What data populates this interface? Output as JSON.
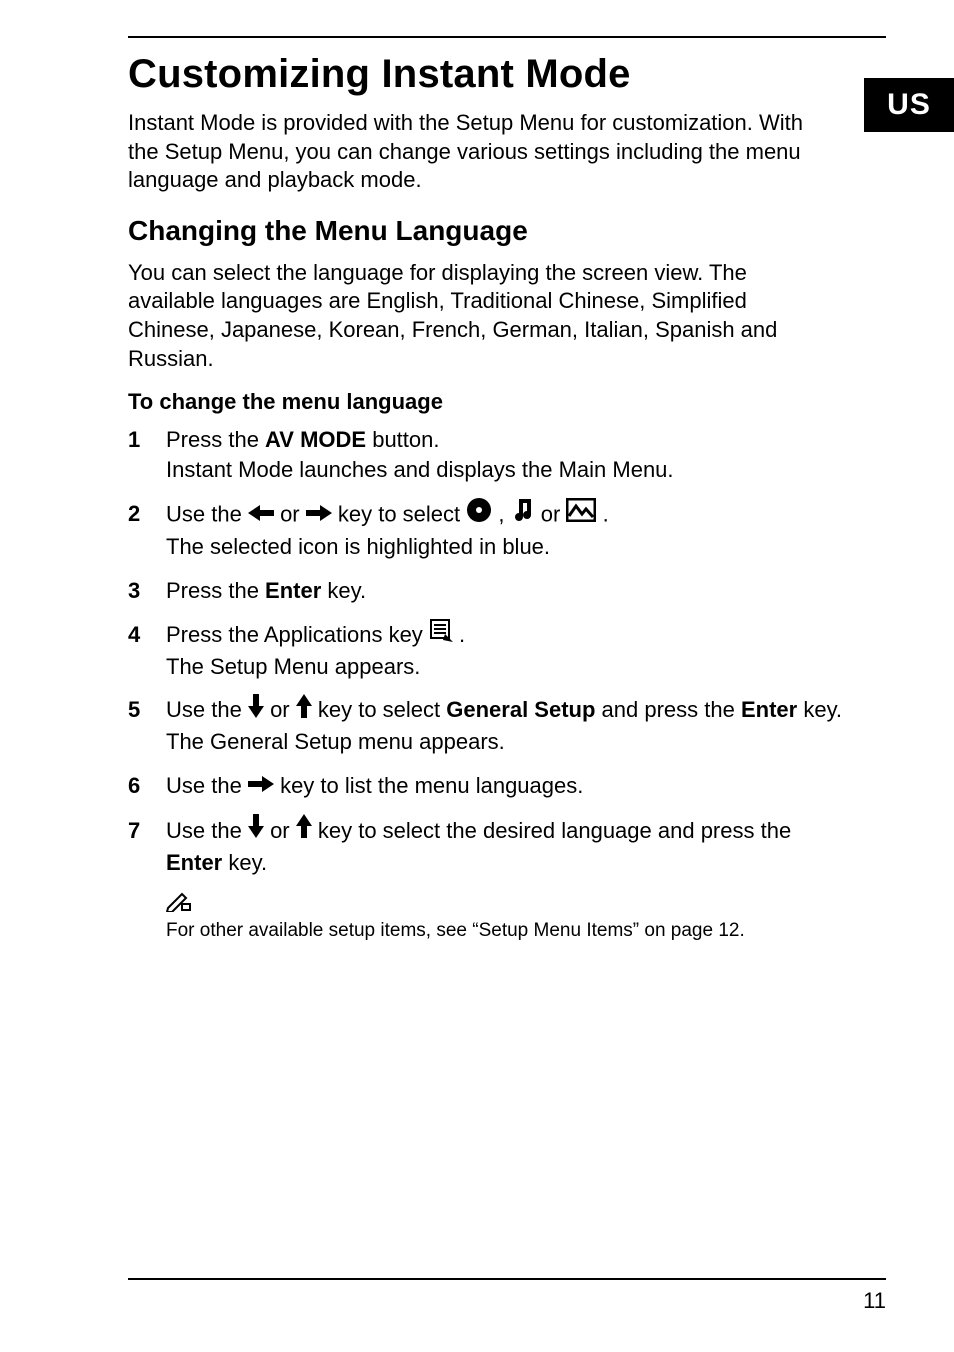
{
  "locale_tab": "US",
  "title": "Customizing Instant Mode",
  "intro": "Instant Mode is provided with the Setup Menu for customization. With the Setup Menu, you can change various settings including the menu language and playback mode.",
  "subhead": "Changing the Menu Language",
  "para_lang": "You can select the language for displaying the screen view. The available languages are English, Traditional Chinese, Simplified Chinese, Japanese, Korean, French, German, Italian, Spanish and Russian.",
  "step_lead": "To change the menu language",
  "steps": {
    "s1": {
      "num": "1",
      "a": "Press the ",
      "b": "AV MODE",
      "c": " button.",
      "d": "Instant Mode launches and displays the Main Menu."
    },
    "s2": {
      "num": "2",
      "a": "Use the ",
      "b": " or ",
      "c": " key to select ",
      "comma": " , ",
      "or": " or ",
      "dot": " .",
      "d": "The selected icon is highlighted in blue."
    },
    "s3": {
      "num": "3",
      "a": "Press the ",
      "b": "Enter",
      "c": " key."
    },
    "s4": {
      "num": "4",
      "a": "Press the Applications key ",
      "dot": " .",
      "b": "The Setup Menu appears."
    },
    "s5": {
      "num": "5",
      "a": "Use the ",
      "b": " or ",
      "c": " key to select ",
      "d": "General Setup",
      "e": " and press the ",
      "f": "Enter",
      "g": " key.",
      "h": "The General Setup menu appears."
    },
    "s6": {
      "num": "6",
      "a": "Use the ",
      "b": " key to list the menu languages."
    },
    "s7": {
      "num": "7",
      "a": "Use the ",
      "b": " or ",
      "c": " key to select the desired language and press the ",
      "d": "Enter",
      "e": " key."
    }
  },
  "note": "For other available setup items, see “Setup Menu Items” on page 12.",
  "page_number": "11"
}
